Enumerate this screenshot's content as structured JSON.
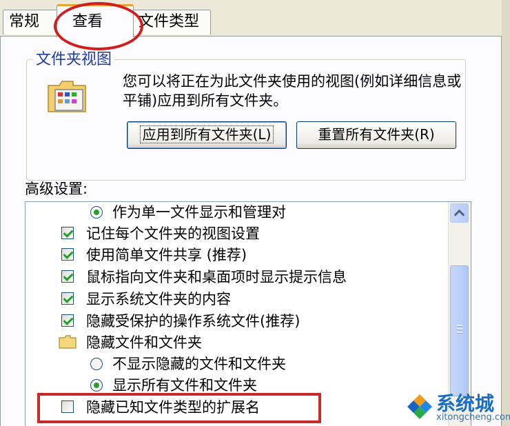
{
  "tabs": {
    "general": "常规",
    "view": "查看",
    "file_types": "文件类型"
  },
  "folder_views": {
    "title": "文件夹视图",
    "description": "您可以将正在为此文件夹使用的视图(例如详细信息或平铺)应用到所有文件夹。",
    "apply_button": "应用到所有文件夹(L)",
    "reset_button": "重置所有文件夹(R)"
  },
  "advanced": {
    "label": "高级设置:",
    "items": [
      {
        "type": "radio",
        "checked": true,
        "label": "作为单一文件显示和管理对"
      },
      {
        "type": "checkbox",
        "checked": true,
        "label": "记住每个文件夹的视图设置"
      },
      {
        "type": "checkbox",
        "checked": true,
        "label": "使用简单文件共享 (推荐)"
      },
      {
        "type": "checkbox",
        "checked": true,
        "label": "鼠标指向文件夹和桌面项时显示提示信息"
      },
      {
        "type": "checkbox",
        "checked": true,
        "label": "显示系统文件夹的内容"
      },
      {
        "type": "checkbox",
        "checked": true,
        "label": "隐藏受保护的操作系统文件(推荐)"
      },
      {
        "type": "folder",
        "label": "隐藏文件和文件夹"
      },
      {
        "type": "radio",
        "checked": false,
        "label": "不显示隐藏的文件和文件夹"
      },
      {
        "type": "radio",
        "checked": true,
        "label": "显示所有文件和文件夹"
      },
      {
        "type": "checkbox",
        "checked": false,
        "label": "隐藏已知文件类型的扩展名"
      }
    ]
  },
  "watermark": {
    "brand": "系统城",
    "site": "xitongcheng.com"
  },
  "colors": {
    "annotation_red": "#d11f1f",
    "window_bg": "#ece9d8",
    "check_green": "#21a121"
  }
}
